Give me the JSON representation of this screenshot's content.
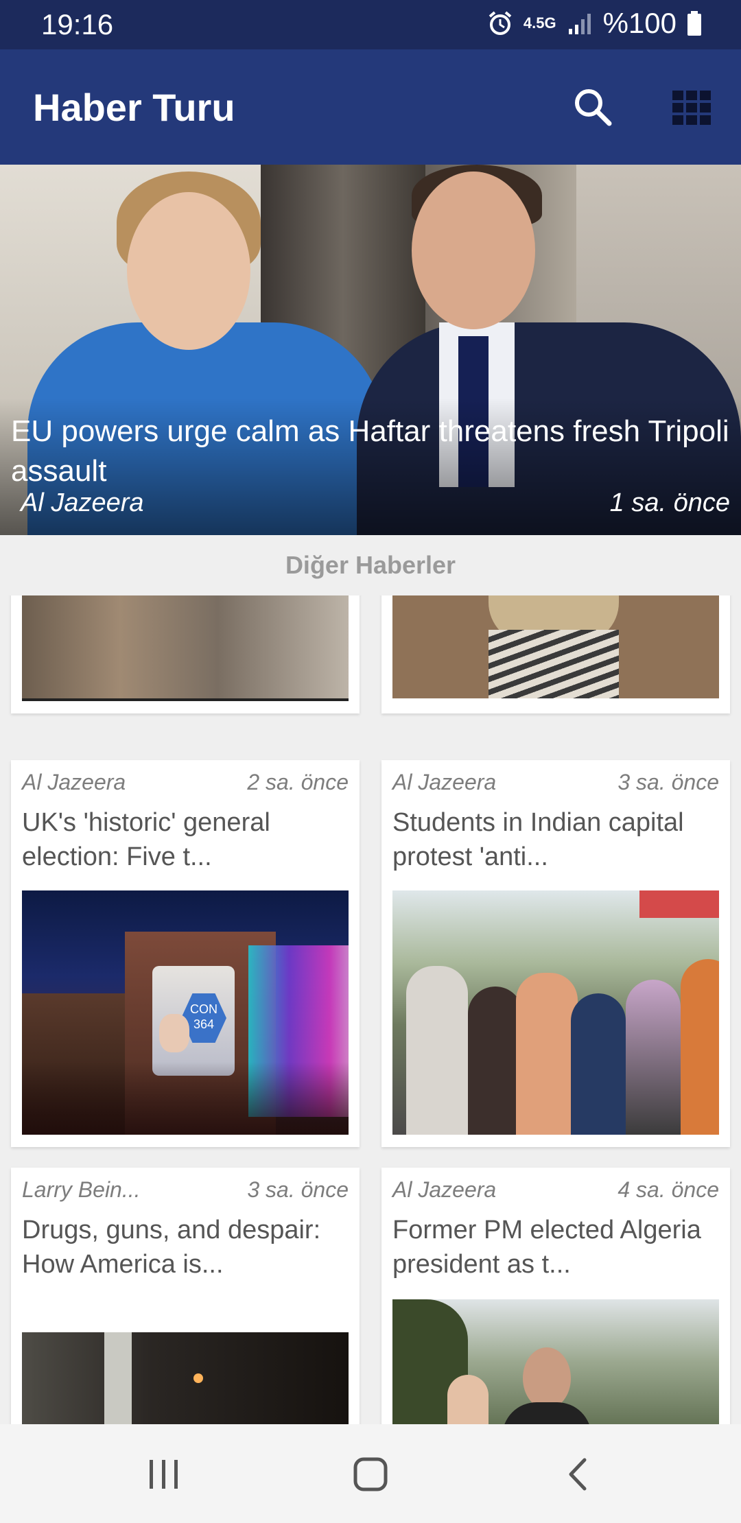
{
  "status_bar": {
    "time": "19:16",
    "network": "4.5G",
    "battery": "%100"
  },
  "app_bar": {
    "title": "Haber Turu"
  },
  "featured": {
    "headline": "EU powers urge calm as Haftar threatens fresh Tripoli assault",
    "source": "Al Jazeera",
    "time_ago": "1 sa. önce"
  },
  "section": {
    "label": "Diğer Haberler"
  },
  "news": [
    {
      "source": "Al Jazeera",
      "time_ago": "2 sa. önce",
      "title": "UK's 'historic' general election: Five t..."
    },
    {
      "source": "Al Jazeera",
      "time_ago": "3 sa. önce",
      "title": "Students in Indian capital protest 'anti..."
    },
    {
      "source": "Larry Bein...",
      "time_ago": "3 sa. önce",
      "title": "Drugs, guns, and despair: How America is..."
    },
    {
      "source": "Al Jazeera",
      "time_ago": "4 sa. önce",
      "title": "Former PM elected Algeria president as t..."
    }
  ],
  "poster_text": {
    "con": "CON",
    "seats": "364"
  },
  "icons": {
    "search": "search-icon",
    "grid": "grid-view-icon",
    "alarm": "alarm-icon",
    "signal": "signal-icon",
    "battery": "battery-icon",
    "recents": "recents-icon",
    "home": "home-icon",
    "back": "back-icon"
  },
  "colors": {
    "status_bar": "#1c2a5c",
    "app_bar": "#24397a",
    "background": "#efefef"
  }
}
